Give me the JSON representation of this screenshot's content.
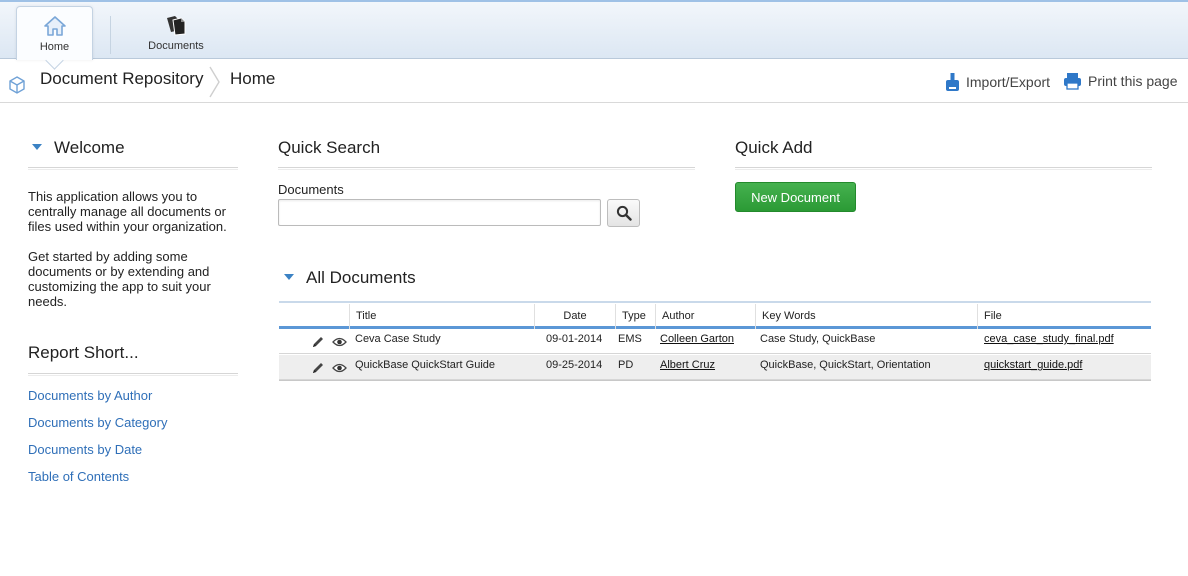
{
  "tabs": [
    {
      "label": "Home",
      "icon": "home-icon",
      "active": true
    },
    {
      "label": "Documents",
      "icon": "documents-icon",
      "active": false
    }
  ],
  "breadcrumb": {
    "app": "Document Repository",
    "page": "Home"
  },
  "actions": {
    "import_export": "Import/Export",
    "print": "Print this page"
  },
  "welcome": {
    "title": "Welcome",
    "para1": "This application allows you to centrally manage all documents or files used within your organization.",
    "para2": "Get started by adding some documents or by extending and customizing the app to suit your needs."
  },
  "report_short": {
    "title": "Report Short...",
    "links": [
      "Documents by Author",
      "Documents by Category",
      "Documents by Date",
      "Table of Contents"
    ]
  },
  "quick_search": {
    "title": "Quick Search",
    "field_label": "Documents",
    "value": "",
    "button_icon": "search-icon"
  },
  "quick_add": {
    "title": "Quick Add",
    "button": "New Document"
  },
  "all_documents": {
    "title": "All Documents",
    "columns": [
      "Title",
      "Date",
      "Type",
      "Author",
      "Key Words",
      "File"
    ],
    "rows": [
      {
        "title": "Ceva Case Study",
        "date": "09-01-2014",
        "type": "EMS",
        "author": "Colleen Garton",
        "keywords": "Case Study, QuickBase",
        "file": "ceva_case_study_final.pdf"
      },
      {
        "title": "QuickBase QuickStart Guide",
        "date": "09-25-2014",
        "type": "PD",
        "author": "Albert Cruz",
        "keywords": "QuickBase, QuickStart, Orientation",
        "file": "quickstart_guide.pdf"
      }
    ]
  },
  "colors": {
    "accent": "#3b82c4",
    "link": "#2f6fb8",
    "button_green": "#2b9a35"
  }
}
